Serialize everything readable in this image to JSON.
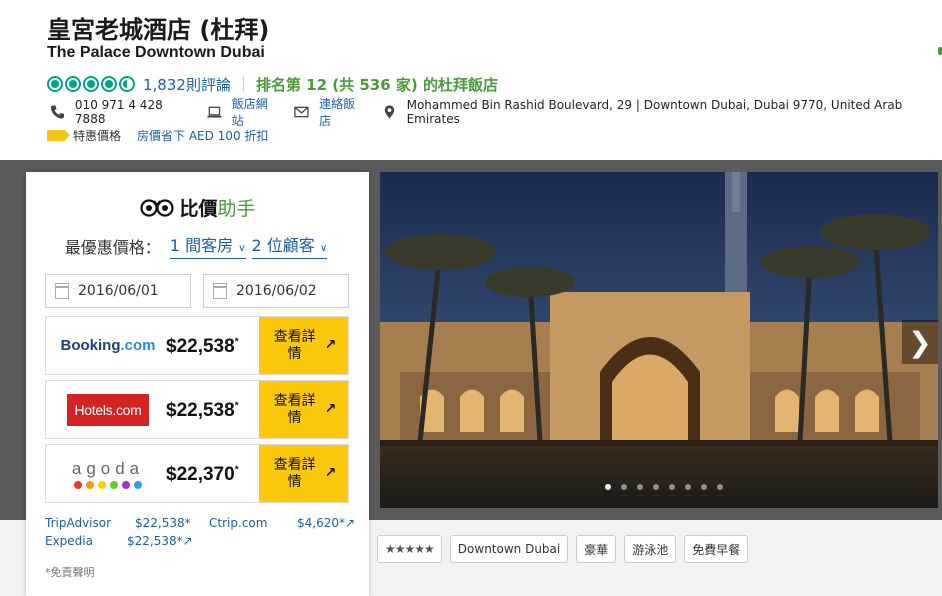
{
  "hotel": {
    "name_zh": "皇宮老城酒店 (杜拜)",
    "name_en": "The Palace Downtown Dubai",
    "rating_bubbles": 4.5,
    "reviews": "1,832則評論",
    "ranking": "排名第 12 (共 536 家) 的杜拜飯店",
    "phone": "010 971 4 428 7888",
    "website": "飯店網站",
    "contact": "連絡飯店",
    "address": "Mohammed Bin Rashid Boulevard, 29 | Downtown Dubai, Dubai 9770, United Arab Emirates",
    "deal_label": "特惠價格",
    "deal_text": "房價省下 AED 100 折扣"
  },
  "widget": {
    "brand_a": "比價",
    "brand_b": "助手",
    "best_label": "最優惠價格：",
    "rooms": "1 間客房",
    "guests": "2 位顧客",
    "checkin": "2016/06/01",
    "checkout": "2016/06/02",
    "view_label": "查看詳情",
    "offers": [
      {
        "provider": "Booking.com",
        "price": "$22,538"
      },
      {
        "provider": "Hotels.com",
        "price": "$22,538"
      },
      {
        "provider": "agoda",
        "price": "$22,370"
      }
    ],
    "more_offers": [
      {
        "provider": "TripAdvisor",
        "price": "$22,538*"
      },
      {
        "provider": "Ctrip.com",
        "price": "$4,620*"
      },
      {
        "provider": "Expedia",
        "price": "$22,538*"
      }
    ],
    "disclaimer": "*免責聲明"
  },
  "tags": [
    "Downtown Dubai",
    "豪華",
    "游泳池",
    "免費早餐"
  ],
  "class_stars": 5,
  "colors": {
    "accent_green": "#00a680",
    "link_blue": "#1a5fa8",
    "button_yellow": "#fcc80c"
  }
}
